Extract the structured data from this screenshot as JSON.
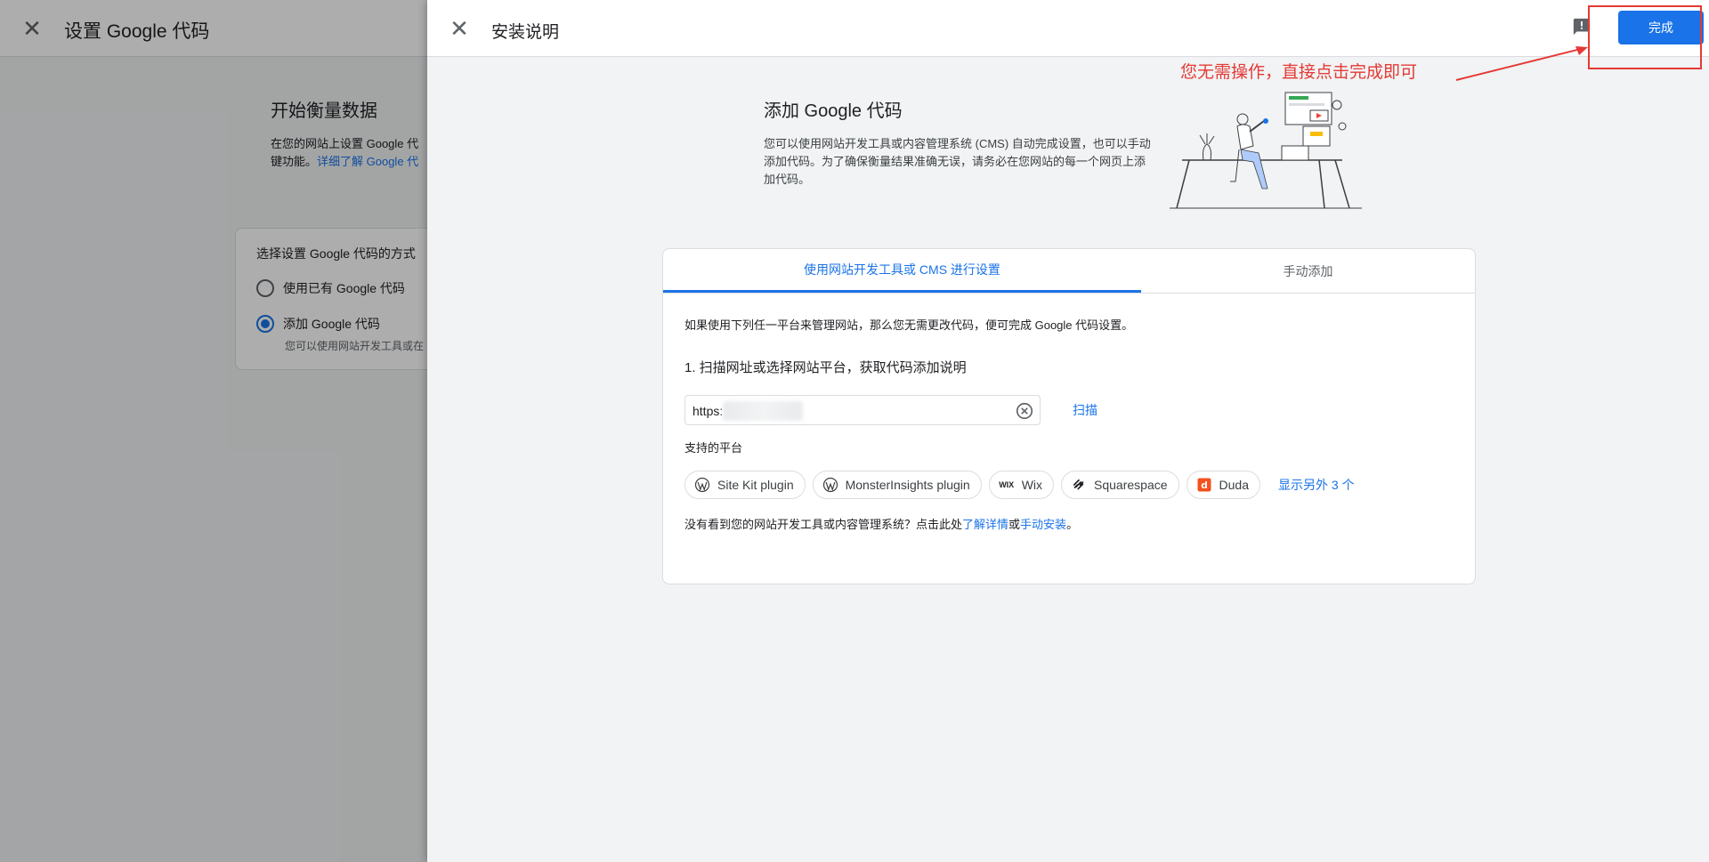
{
  "background": {
    "close_glyph": "✕",
    "title": "设置 Google 代码",
    "heading": "开始衡量数据",
    "desc_line1": "在您的网站上设置 Google 代",
    "desc_line2_prefix": "键功能。",
    "desc_link": "详细了解 Google 代",
    "card_title": "选择设置 Google 代码的方式",
    "option_existing": "使用已有 Google 代码",
    "option_add": "添加 Google 代码",
    "option_add_sub": "您可以使用网站开发工具或在"
  },
  "drawer": {
    "close_glyph": "✕",
    "title": "安装说明",
    "done_label": "完成",
    "intro_title": "添加 Google 代码",
    "intro_desc": "您可以使用网站开发工具或内容管理系统 (CMS) 自动完成设置，也可以手动添加代码。为了确保衡量结果准确无误，请务必在您网站的每一个网页上添加代码。",
    "tabs": [
      {
        "label": "使用网站开发工具或 CMS 进行设置"
      },
      {
        "label": "手动添加"
      }
    ],
    "cms_intro": "如果使用下列任一平台来管理网站，那么您无需更改代码，便可完成 Google 代码设置。",
    "step1": "1. 扫描网址或选择网站平台，获取代码添加说明",
    "url_value": "https:",
    "scan_label": "扫描",
    "platforms_label": "支持的平台",
    "platforms": [
      {
        "name": "Site Kit plugin",
        "icon": "wordpress-icon"
      },
      {
        "name": "MonsterInsights plugin",
        "icon": "wordpress-icon"
      },
      {
        "name": "Wix",
        "icon": "wix-icon"
      },
      {
        "name": "Squarespace",
        "icon": "squarespace-icon"
      },
      {
        "name": "Duda",
        "icon": "duda-icon"
      }
    ],
    "show_more": "显示另外 3 个",
    "not_found_prefix": "没有看到您的网站开发工具或内容管理系统？点击此处",
    "learn_more": "了解详情",
    "or": "或",
    "manual_install": "手动安装",
    "period": "。"
  },
  "annotation": {
    "text": "您无需操作，直接点击完成即可",
    "color": "#e53935"
  },
  "colors": {
    "accent": "#1a73e8",
    "annotation": "#e53935"
  }
}
